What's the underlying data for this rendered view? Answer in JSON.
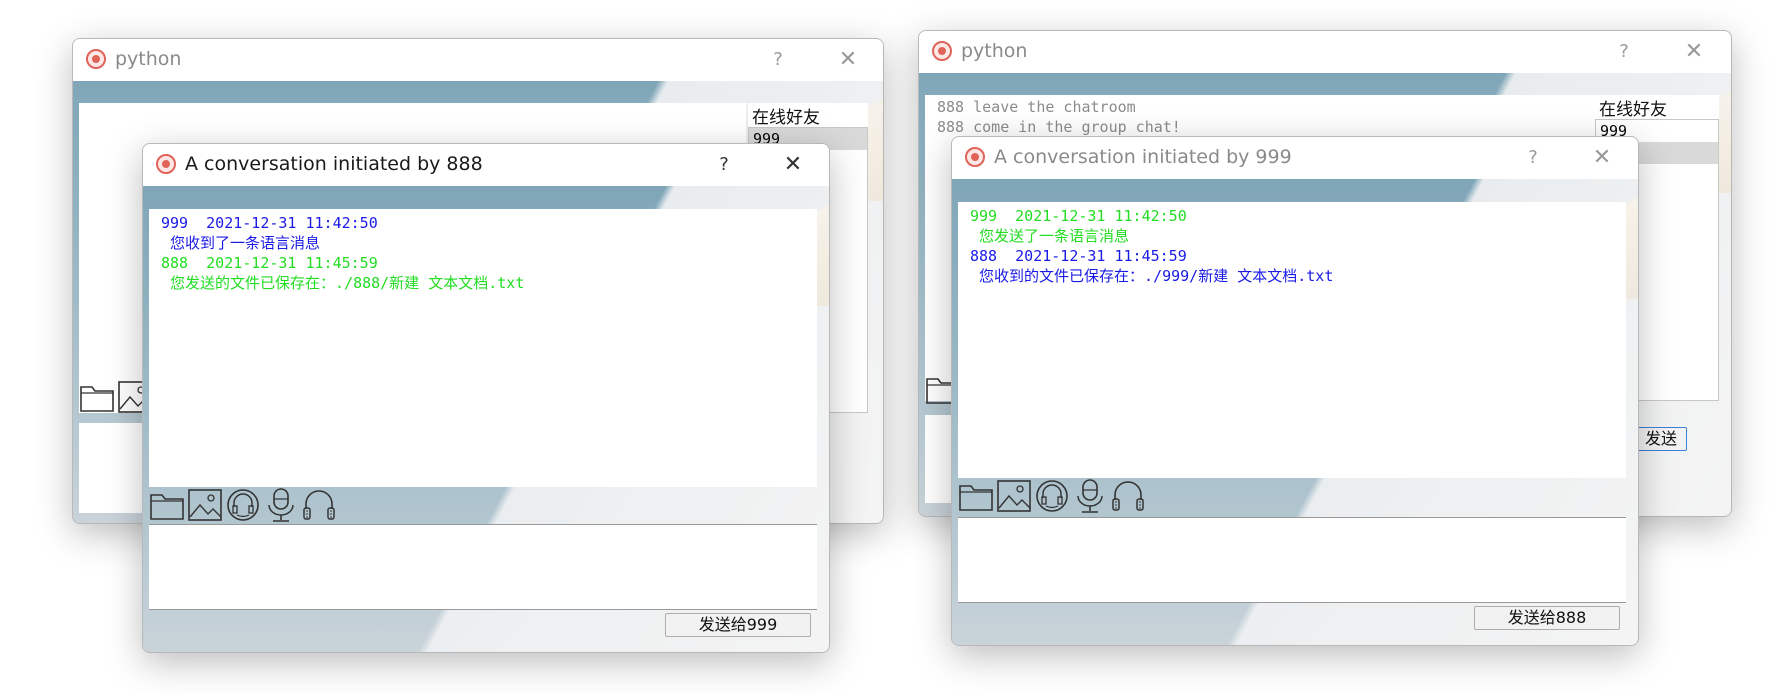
{
  "colors": {
    "sent_blue": "#1a1ae6",
    "recv_green": "#22dd22",
    "status_gray": "#8c8c8c"
  },
  "windows": {
    "main_left": {
      "title": "python",
      "help": "?",
      "close": "✕",
      "friends_label": "在线好友",
      "friends": [
        "999"
      ],
      "icons": [
        "folder-icon",
        "image-icon"
      ]
    },
    "main_right": {
      "title": "python",
      "help": "?",
      "close": "✕",
      "chat_lines": [
        "888 leave the chatroom",
        "888 come in the group chat!"
      ],
      "friends_label": "在线好友",
      "friends": [
        "999"
      ],
      "send_label": "发送",
      "icons": [
        "folder-icon"
      ]
    },
    "conv_888": {
      "title": "A conversation initiated by 888",
      "help": "?",
      "close": "✕",
      "messages": [
        {
          "header": "999  2021-12-31 11:42:50",
          "body": " 您收到了一条语言消息",
          "color": "blue"
        },
        {
          "header": "888  2021-12-31 11:45:59",
          "body": " 您发送的文件已保存在：./888/新建 文本文档.txt",
          "color": "green"
        }
      ],
      "toolbar": [
        "folder-icon",
        "image-icon",
        "headset-icon",
        "microphone-icon",
        "headphones-icon"
      ],
      "input_value": "",
      "send_label": "发送给999"
    },
    "conv_999": {
      "title": "A conversation initiated by 999",
      "help": "?",
      "close": "✕",
      "messages": [
        {
          "header": "999  2021-12-31 11:42:50",
          "body": " 您发送了一条语言消息",
          "color": "green"
        },
        {
          "header": "888  2021-12-31 11:45:59",
          "body": " 您收到的文件已保存在：./999/新建 文本文档.txt",
          "color": "blue"
        }
      ],
      "toolbar": [
        "folder-icon",
        "image-icon",
        "headset-icon",
        "microphone-icon",
        "headphones-icon"
      ],
      "input_value": "",
      "send_label": "发送给888"
    }
  }
}
